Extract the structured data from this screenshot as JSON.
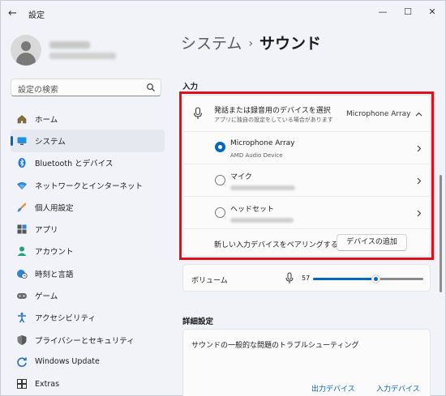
{
  "window": {
    "title": "設定",
    "back": "←",
    "minimize": "—",
    "maximize": "☐",
    "close": "✕"
  },
  "search": {
    "placeholder": "設定の検索"
  },
  "nav": [
    {
      "label": "ホーム",
      "icon": "home-icon"
    },
    {
      "label": "システム",
      "icon": "monitor-icon",
      "active": true
    },
    {
      "label": "Bluetooth とデバイス",
      "icon": "bluetooth-icon"
    },
    {
      "label": "ネットワークとインターネット",
      "icon": "wifi-icon"
    },
    {
      "label": "個人用設定",
      "icon": "brush-icon"
    },
    {
      "label": "アプリ",
      "icon": "apps-icon"
    },
    {
      "label": "アカウント",
      "icon": "person-icon"
    },
    {
      "label": "時刻と言語",
      "icon": "globe-clock-icon"
    },
    {
      "label": "ゲーム",
      "icon": "gamepad-icon"
    },
    {
      "label": "アクセシビリティ",
      "icon": "accessibility-icon"
    },
    {
      "label": "プライバシーとセキュリティ",
      "icon": "shield-icon"
    },
    {
      "label": "Windows Update",
      "icon": "update-icon"
    },
    {
      "label": "Extras",
      "icon": "extras-icon"
    }
  ],
  "breadcrumb": {
    "parent": "システム",
    "separator": "›",
    "current": "サウンド"
  },
  "input": {
    "section_label": "入力",
    "select_title": "発話または録音用のデバイスを選択",
    "select_subtitle": "アプリに独自の設定をしている場合があります",
    "selected_device": "Microphone Array",
    "devices": [
      {
        "name": "Microphone Array",
        "detail": "AMD Audio Device",
        "selected": true
      },
      {
        "name": "マイク",
        "detail": "",
        "selected": false
      },
      {
        "name": "ヘッドセット",
        "detail": "",
        "selected": false
      }
    ],
    "pair_text": "新しい入力デバイスをペアリングする",
    "add_device_button": "デバイスの追加",
    "volume_label": "ボリューム",
    "volume_value": "57",
    "volume_level": 0.57
  },
  "advanced": {
    "section_label": "詳細設定",
    "troubleshoot_title": "サウンドの一般的な問題のトラブルシューティング",
    "output_devices_link": "出力デバイス",
    "input_devices_link": "入力デバイス"
  },
  "colors": {
    "accent": "#0067c0",
    "highlight_box": "#e00f1a"
  }
}
